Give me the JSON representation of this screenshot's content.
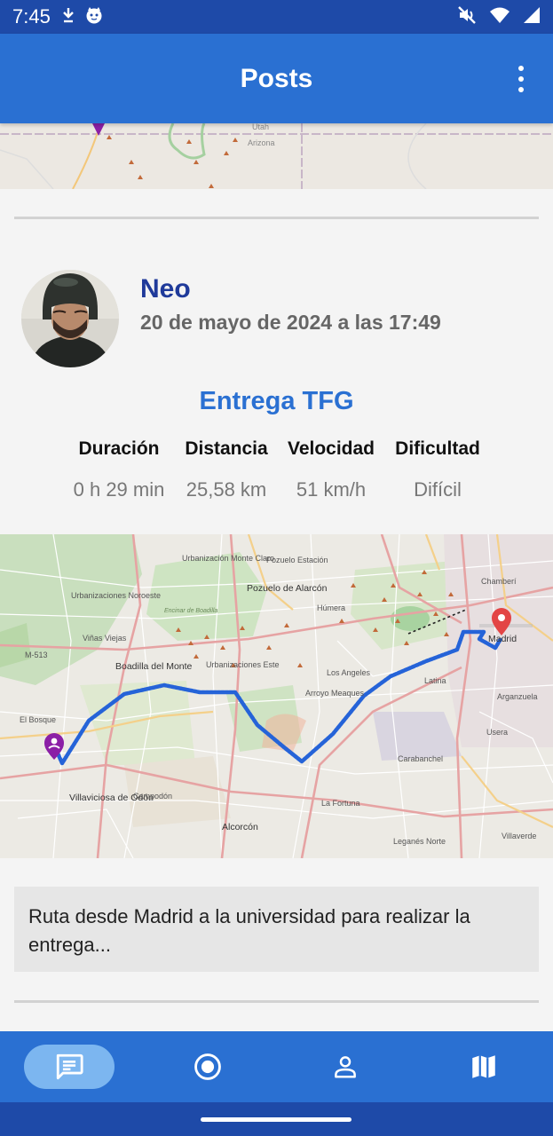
{
  "status_bar": {
    "time": "7:45",
    "left_icons": [
      "download-icon",
      "cat-face-icon"
    ],
    "right_icons": [
      "mute-icon",
      "wifi-icon",
      "signal-icon"
    ]
  },
  "app_bar": {
    "title": "Posts",
    "menu_icon": "more-vert-icon"
  },
  "top_map": {
    "labels": [
      "Utah",
      "Arizona"
    ]
  },
  "post": {
    "username": "Neo",
    "date": "20 de mayo de 2024 a las 17:49",
    "title": "Entrega TFG",
    "stats": [
      {
        "label": "Duración",
        "value": "0 h 29 min"
      },
      {
        "label": "Distancia",
        "value": "25,58 km"
      },
      {
        "label": "Velocidad",
        "value": "51 km/h"
      },
      {
        "label": "Dificultad",
        "value": "Difícil"
      }
    ],
    "map_labels": [
      "Urbanización Monte Claro",
      "Pozuelo Estación",
      "Pozuelo de Alarcón",
      "Húmera",
      "Urbanizaciones Noroeste",
      "Viñas Viejas",
      "M-513",
      "Boadilla del Monte",
      "Urbanizaciones Este",
      "Los Angeles",
      "Arroyo Meaques",
      "Latina",
      "El Bosque",
      "Villaviciosa de Odón",
      "Campodón",
      "Carabanchel",
      "La Fortuna",
      "Alcorcón",
      "Leganés Norte",
      "Madrid",
      "Chamberí",
      "Arganzuela",
      "Usera",
      "Villaverde",
      "Encinar de Boadilla"
    ],
    "description": "Ruta desde Madrid a la universidad para realizar la entrega..."
  },
  "bottom_nav": {
    "items": [
      {
        "icon": "chat-icon",
        "active": true
      },
      {
        "icon": "record-icon",
        "active": false
      },
      {
        "icon": "person-icon",
        "active": false
      },
      {
        "icon": "map-icon",
        "active": false
      }
    ]
  },
  "colors": {
    "primary": "#2a70d2",
    "status_bar": "#1e4aa8",
    "username": "#1f3a9a",
    "route": "#2563d8",
    "start_marker": "#8b1fa6",
    "end_marker": "#e34545"
  }
}
